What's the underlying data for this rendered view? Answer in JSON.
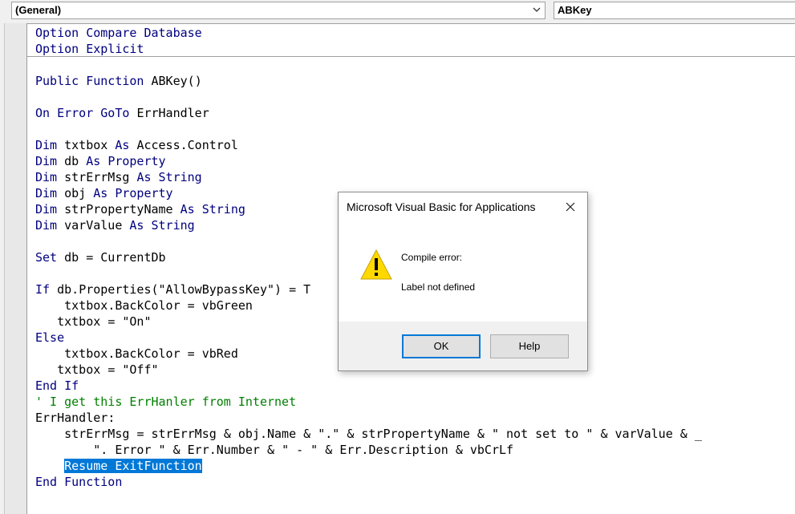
{
  "toolbar": {
    "object_combo": "(General)",
    "procedure_combo": "ABKey"
  },
  "code_lines": [
    "Option Compare Database",
    "Option Explicit",
    "",
    "Public Function ABKey()",
    "",
    "On Error GoTo ErrHandler",
    "",
    "Dim txtbox As Access.Control",
    "Dim db As Property",
    "Dim strErrMsg As String",
    "Dim obj As Property",
    "Dim strPropertyName As String",
    "Dim varValue As String",
    "",
    "Set db = CurrentDb",
    "",
    "If db.Properties(\"AllowBypassKey\") = T",
    "    txtbox.BackColor = vbGreen",
    "   txtbox = \"On\"",
    "Else",
    "    txtbox.BackColor = vbRed",
    "   txtbox = \"Off\"",
    "End If",
    "' I get this ErrHanler from Internet",
    "ErrHandler:",
    "    strErrMsg = strErrMsg & obj.Name & \".\" & strPropertyName & \" not set to \" & varValue & _",
    "        \". Error \" & Err.Number & \" - \" & Err.Description & vbCrLf",
    "    Resume ExitFunction",
    "End Function"
  ],
  "selected_line_index": 27,
  "keywords": [
    "Option",
    "Compare",
    "Database",
    "Explicit",
    "Public",
    "Function",
    "On",
    "Error",
    "GoTo",
    "Dim",
    "As",
    "Property",
    "String",
    "Set",
    "If",
    "Else",
    "End",
    "Resume"
  ],
  "colors": {
    "keyword": "#00007f",
    "comment": "#007f00",
    "selection": "#0078d7",
    "warning": "#ffd800"
  },
  "dialog": {
    "title": "Microsoft Visual Basic for Applications",
    "icon": "warning-icon",
    "message_line1": "Compile error:",
    "message_line2": "Label not defined",
    "ok_label": "OK",
    "help_label": "Help"
  }
}
